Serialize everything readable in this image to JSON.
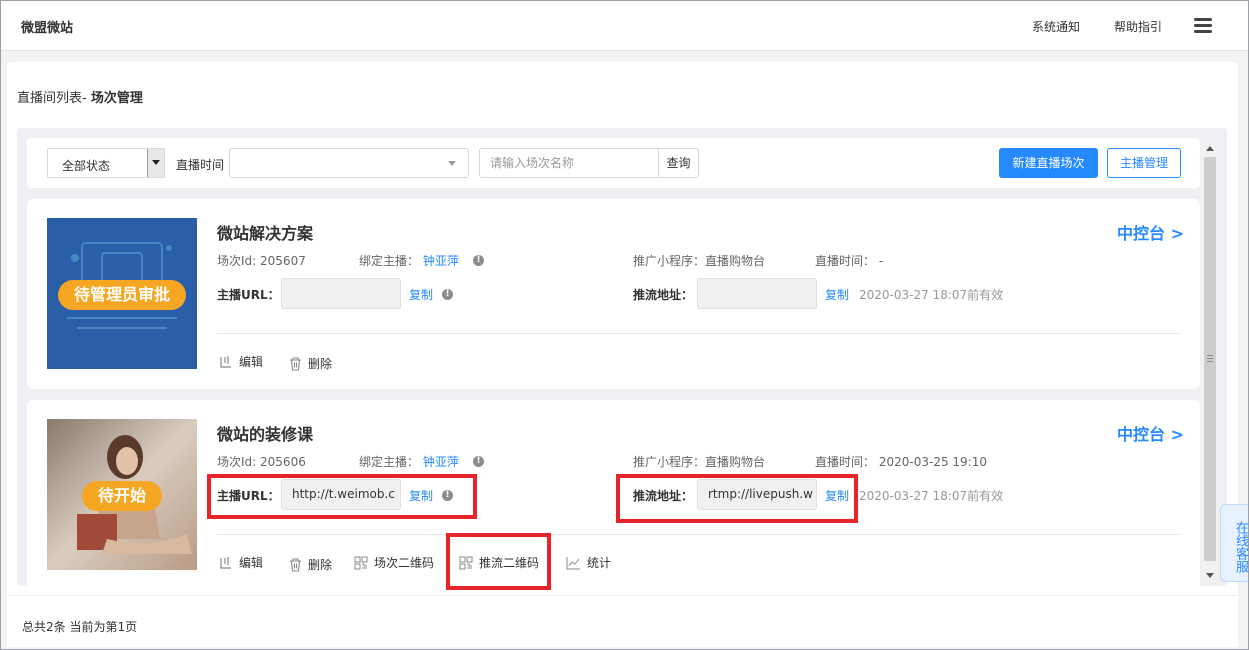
{
  "header": {
    "brand": "微盟微站",
    "notify_label": "系统通知",
    "help_label": "帮助指引"
  },
  "breadcrumb": {
    "prefix": "直播间列表- ",
    "current": "场次管理"
  },
  "filters": {
    "status_value": "全部状态",
    "time_label": "直播时间",
    "search_placeholder": "请输入场次名称",
    "search_button": "查询",
    "new_button": "新建直播场次",
    "anchor_button": "主播管理"
  },
  "sessions": [
    {
      "title": "微站解决方案",
      "badge": "待管理员审批",
      "console_link": "中控台 >",
      "id_label": "场次Id:",
      "id_value": "205607",
      "anchor_label": "绑定主播：",
      "anchor_value": "钟亚萍",
      "program_label": "推广小程序：",
      "program_value": "直播购物台",
      "time_label": "直播时间：",
      "time_value": "-",
      "url_label": "主播URL：",
      "url_value": "",
      "push_label": "推流地址：",
      "push_value": "",
      "copy_label": "复制",
      "valid_text": "2020-03-27 18:07前有效",
      "actions": [
        "编辑",
        "删除"
      ]
    },
    {
      "title": "微站的装修课",
      "badge": "待开始",
      "console_link": "中控台 >",
      "id_label": "场次Id:",
      "id_value": "205606",
      "anchor_label": "绑定主播：",
      "anchor_value": "钟亚萍",
      "program_label": "推广小程序：",
      "program_value": "直播购物台",
      "time_label": "直播时间：",
      "time_value": "2020-03-25 19:10",
      "url_label": "主播URL：",
      "url_value": "http://t.weimob.c",
      "push_label": "推流地址：",
      "push_value": "rtmp://livepush.w",
      "copy_label": "复制",
      "valid_text": "2020-03-27 18:07前有效",
      "actions": [
        "编辑",
        "删除",
        "场次二维码",
        "推流二维码",
        "统计"
      ]
    }
  ],
  "footer": {
    "summary": "总共2条 当前为第1页"
  },
  "online_service": "在线客服",
  "colors": {
    "primary": "#2589ff",
    "badge": "#f5a623",
    "highlight": "#e8242b",
    "thumb1": "#2a5ea8"
  },
  "icons": [
    "menu-icon",
    "info-icon",
    "edit-icon",
    "delete-icon",
    "qrcode-icon",
    "chart-icon",
    "dropdown-arrow-icon"
  ]
}
